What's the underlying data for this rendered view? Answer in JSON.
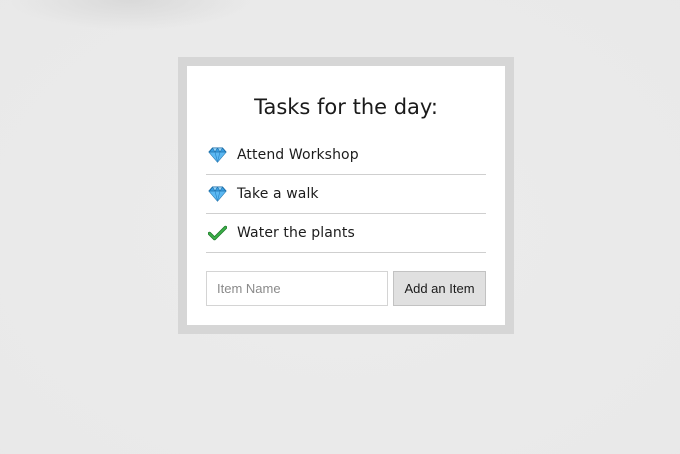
{
  "app": {
    "title": "Tasks for the day:"
  },
  "tasks": [
    {
      "label": "Attend Workshop",
      "icon": "gem-icon"
    },
    {
      "label": "Take a walk",
      "icon": "gem-icon"
    },
    {
      "label": "Water the plants",
      "icon": "check-mark-icon"
    }
  ],
  "form": {
    "input_value": "",
    "input_placeholder": "Item Name",
    "add_button_label": "Add an Item"
  },
  "colors": {
    "background": "#ebebeb",
    "card_border": "#d6d6d6",
    "card": "#ffffff",
    "gem_blue": "#3aa0e6",
    "check_green": "#2e9a3a",
    "button_bg": "#e0e0e0"
  }
}
